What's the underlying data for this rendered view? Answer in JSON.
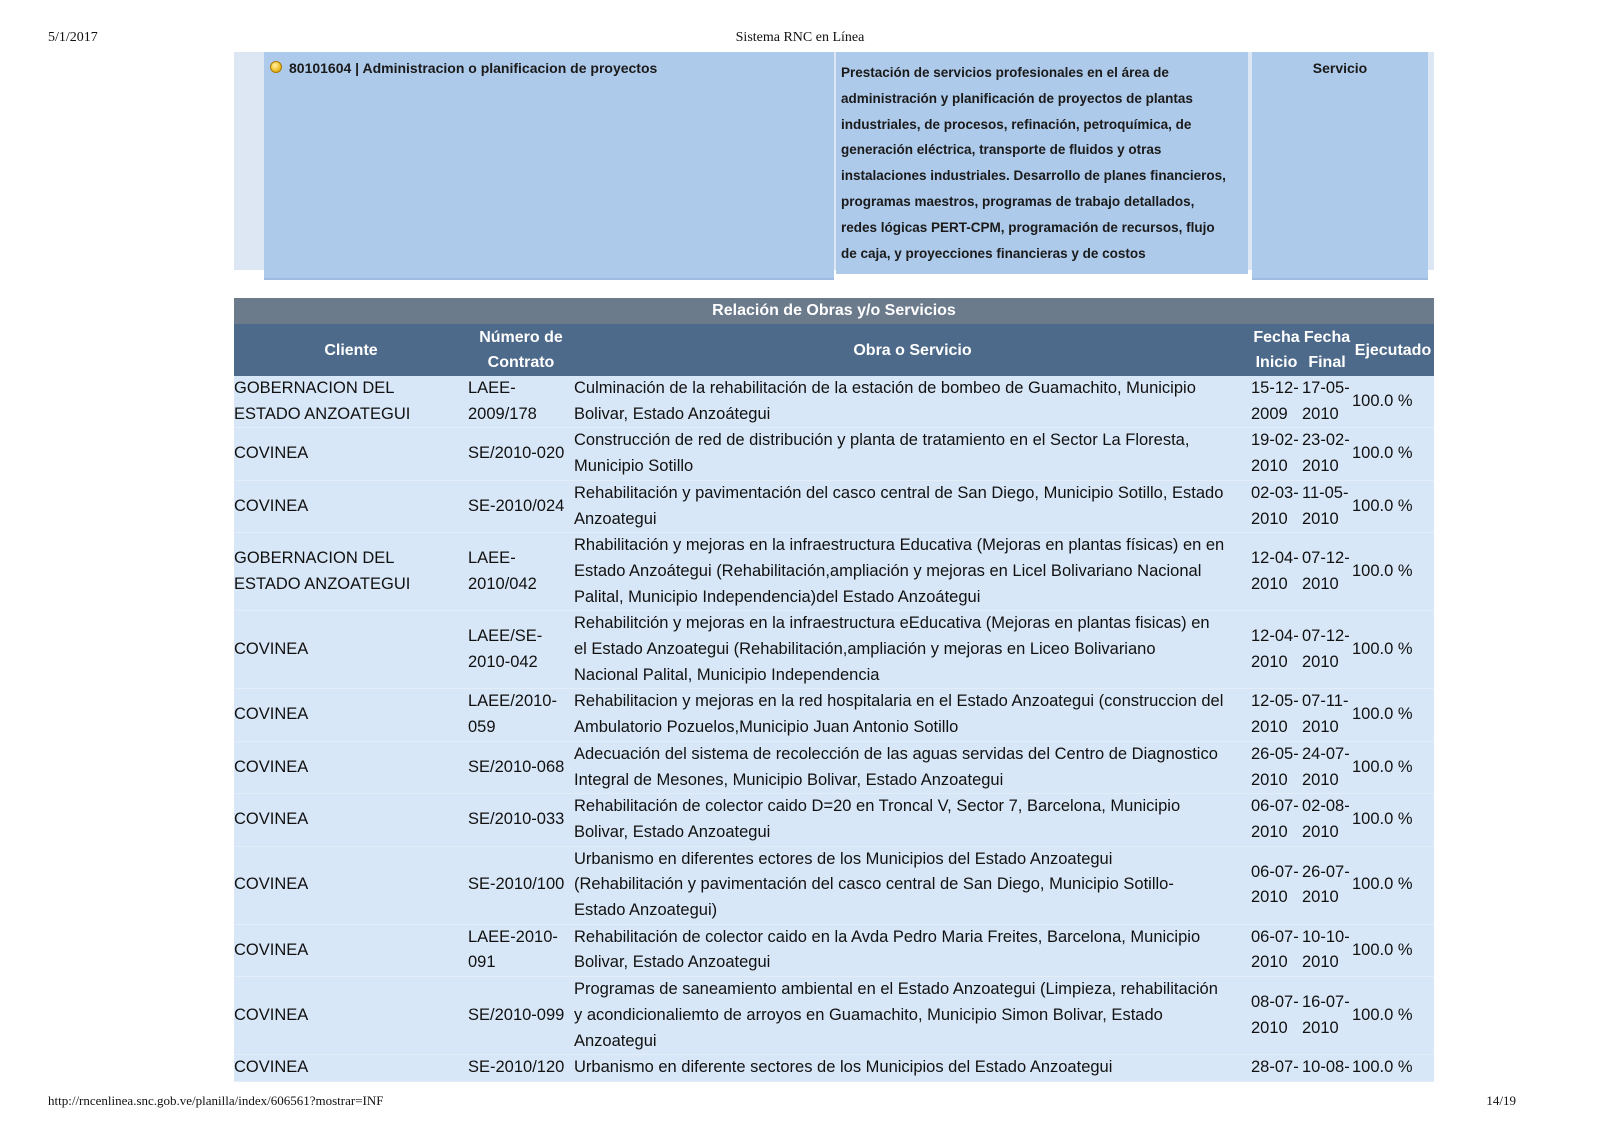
{
  "print_header": {
    "date": "5/1/2017",
    "title": "Sistema RNC en Línea"
  },
  "print_footer": {
    "url": "http://rncenlinea.snc.gob.ve/planilla/index/606561?mostrar=INF",
    "page": "14/19"
  },
  "activity": {
    "code_label": "80101604 | Administracion o planificacion de proyectos",
    "description_lines": [
      "Prestación de servicios profesionales en el área de",
      "administración y planificación de proyectos de plantas",
      "industriales, de procesos, refinación, petroquímica, de",
      "generación eléctrica, transporte de fluidos y otras",
      "instalaciones industriales. Desarrollo de planes financieros,",
      "programas maestros, programas de trabajo detallados,",
      "redes lógicas PERT-CPM, programación de recursos, flujo",
      "de caja, y proyecciones financieras y de costos"
    ],
    "type": "Servicio"
  },
  "works_table": {
    "caption": "Relación de Obras y/o Servicios",
    "headers": {
      "cliente": "Cliente",
      "contrato": [
        "Número de",
        "Contrato"
      ],
      "obra": "Obra o Servicio",
      "inicio": [
        "Fecha",
        "Inicio"
      ],
      "final": [
        "Fecha",
        "Final"
      ],
      "ejecutado": "Ejecutado"
    },
    "rows": [
      {
        "cliente": [
          "GOBERNACION DEL",
          "ESTADO ANZOATEGUI"
        ],
        "contrato": [
          "LAEE-",
          "2009/178"
        ],
        "obra": [
          "Culminación de la rehabilitación de la estación de bombeo de Guamachito, Municipio",
          "Bolivar, Estado Anzoátegui"
        ],
        "inicio": [
          "15-12-",
          "2009"
        ],
        "final": [
          "17-05-",
          "2010"
        ],
        "ejecutado": "100.0 %"
      },
      {
        "cliente": [
          "COVINEA"
        ],
        "contrato": [
          "SE/2010-020"
        ],
        "obra": [
          "Construcción de red de distribución y planta de tratamiento en el Sector La Floresta,",
          "Municipio Sotillo"
        ],
        "inicio": [
          "19-02-",
          "2010"
        ],
        "final": [
          "23-02-",
          "2010"
        ],
        "ejecutado": "100.0 %"
      },
      {
        "cliente": [
          "COVINEA"
        ],
        "contrato": [
          "SE-2010/024"
        ],
        "obra": [
          "Rehabilitación y pavimentación del casco central de San Diego, Municipio Sotillo, Estado",
          "Anzoategui"
        ],
        "inicio": [
          "02-03-",
          "2010"
        ],
        "final": [
          "11-05-",
          "2010"
        ],
        "ejecutado": "100.0 %"
      },
      {
        "cliente": [
          "GOBERNACION DEL",
          "ESTADO ANZOATEGUI"
        ],
        "contrato": [
          "LAEE-",
          "2010/042"
        ],
        "obra": [
          "Rhabilitación y mejoras en la infraestructura Educativa (Mejoras en plantas físicas) en en",
          "Estado Anzoátegui (Rehabilitación,ampliación y mejoras en Licel Bolivariano Nacional",
          "Palital, Municipio Independencia)del Estado Anzoátegui"
        ],
        "inicio": [
          "12-04-",
          "2010"
        ],
        "final": [
          "07-12-",
          "2010"
        ],
        "ejecutado": "100.0 %"
      },
      {
        "cliente": [
          "COVINEA"
        ],
        "contrato": [
          "LAEE/SE-",
          "2010-042"
        ],
        "obra": [
          "Rehabilitción y mejoras en la infraestructura eEducativa (Mejoras en plantas fisicas) en",
          "el Estado Anzoategui (Rehabilitación,ampliación y mejoras en Liceo Bolivariano",
          "Nacional Palital, Municipio Independencia"
        ],
        "inicio": [
          "12-04-",
          "2010"
        ],
        "final": [
          "07-12-",
          "2010"
        ],
        "ejecutado": "100.0 %"
      },
      {
        "cliente": [
          "COVINEA"
        ],
        "contrato": [
          "LAEE/2010-",
          "059"
        ],
        "obra": [
          "Rehabilitacion y mejoras en la red hospitalaria en el Estado Anzoategui (construccion del",
          "Ambulatorio Pozuelos,Municipio Juan Antonio Sotillo"
        ],
        "inicio": [
          "12-05-",
          "2010"
        ],
        "final": [
          "07-11-",
          "2010"
        ],
        "ejecutado": "100.0 %"
      },
      {
        "cliente": [
          "COVINEA"
        ],
        "contrato": [
          "SE/2010-068"
        ],
        "obra": [
          "Adecuación del sistema de recolección de las aguas servidas del Centro de Diagnostico",
          "Integral de Mesones, Municipio Bolivar, Estado Anzoategui"
        ],
        "inicio": [
          "26-05-",
          "2010"
        ],
        "final": [
          "24-07-",
          "2010"
        ],
        "ejecutado": "100.0 %"
      },
      {
        "cliente": [
          "COVINEA"
        ],
        "contrato": [
          "SE/2010-033"
        ],
        "obra": [
          "Rehabilitación de colector caido D=20 en Troncal V, Sector 7, Barcelona, Municipio",
          "Bolivar, Estado Anzoategui"
        ],
        "inicio": [
          "06-07-",
          "2010"
        ],
        "final": [
          "02-08-",
          "2010"
        ],
        "ejecutado": "100.0 %"
      },
      {
        "cliente": [
          "COVINEA"
        ],
        "contrato": [
          "SE-2010/100"
        ],
        "obra": [
          "Urbanismo en diferentes ectores de los Municipios del Estado Anzoategui",
          "(Rehabilitación y pavimentación del casco central de San Diego, Municipio Sotillo-",
          "Estado Anzoategui)"
        ],
        "inicio": [
          "06-07-",
          "2010"
        ],
        "final": [
          "26-07-",
          "2010"
        ],
        "ejecutado": "100.0 %"
      },
      {
        "cliente": [
          "COVINEA"
        ],
        "contrato": [
          "LAEE-2010-",
          "091"
        ],
        "obra": [
          "Rehabilitación de colector caido en la Avda Pedro Maria Freites, Barcelona, Municipio",
          "Bolivar, Estado Anzoategui"
        ],
        "inicio": [
          "06-07-",
          "2010"
        ],
        "final": [
          "10-10-",
          "2010"
        ],
        "ejecutado": "100.0 %"
      },
      {
        "cliente": [
          "COVINEA"
        ],
        "contrato": [
          "SE/2010-099"
        ],
        "obra": [
          "Programas de saneamiento ambiental en el Estado Anzoategui (Limpieza, rehabilitación",
          "y acondicionaliemto de arroyos en Guamachito, Municipio Simon Bolivar, Estado",
          "Anzoategui"
        ],
        "inicio": [
          "08-07-",
          "2010"
        ],
        "final": [
          "16-07-",
          "2010"
        ],
        "ejecutado": "100.0 %"
      },
      {
        "cliente": [
          "COVINEA"
        ],
        "contrato": [
          "SE-2010/120"
        ],
        "obra": [
          "Urbanismo en diferente sectores de los Municipios del Estado Anzoategui"
        ],
        "inicio": [
          "28-07-"
        ],
        "final": [
          "10-08-"
        ],
        "ejecutado": "100.0 %"
      }
    ]
  }
}
